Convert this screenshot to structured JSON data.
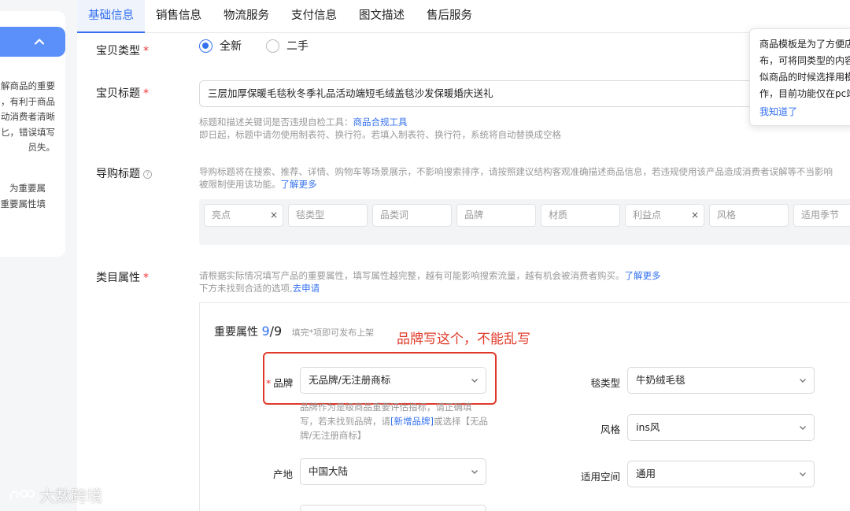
{
  "left_panel": {
    "text1": [
      "解商品的重要",
      "，有利于商品",
      "动消费者清晰",
      "匕，错误填写",
      "员失。"
    ],
    "text2": [
      "为重要属",
      "重要属性填"
    ]
  },
  "tabs": [
    "基础信息",
    "销售信息",
    "物流服务",
    "支付信息",
    "图文描述",
    "售后服务"
  ],
  "item_type": {
    "label": "宝贝类型",
    "options": [
      "全新",
      "二手"
    ],
    "selected": "全新"
  },
  "item_title": {
    "label": "宝贝标题",
    "value": "三层加厚保暖毛毯秋冬季礼品活动端短毛绒盖毯沙发保暖婚庆送礼",
    "hint_line1_prefix": "标题和描述关键词是否违规自检工具：",
    "hint_line1_link": "商品合规工具",
    "hint_line2": "即日起，标题中请勿使用制表符、换行符。若填入制表符、换行符，系统将自动替换成空格"
  },
  "guide_title": {
    "label": "导购标题",
    "hint_line1": "导购标题将在搜索、推荐、详情、购物车等场景展示，不影响搜索排序，请按照建议结构客观准确描述商品信息，若违规使用该产品造成消费者误解等不当影响",
    "hint_line2_prefix": "被限制使用该功能。",
    "hint_line2_link": "了解更多",
    "chips": [
      {
        "text": "亮点",
        "clear": "×"
      },
      {
        "text": "毯类型",
        "clear": ""
      },
      {
        "text": "品类词",
        "clear": ""
      },
      {
        "text": "品牌",
        "clear": ""
      },
      {
        "text": "材质",
        "clear": ""
      },
      {
        "text": "利益点",
        "clear": "×"
      },
      {
        "text": "风格",
        "clear": ""
      },
      {
        "text": "适用季节",
        "clear": ""
      }
    ]
  },
  "category_attrs": {
    "label": "类目属性",
    "hint_line1_prefix": "请根据实际情况填写产品的重要属性，填写属性越完整，越有可能影响搜索流量，越有机会被消费者购买。",
    "hint_line1_link": "了解更多",
    "hint_line2_prefix": "下方未找到合适的选项,",
    "hint_line2_link": "去申请",
    "section_title": "重要属性",
    "count_filled": "9",
    "count_total": "/9",
    "section_hint": "填完*项即可发布上架",
    "annotation": "品牌写这个，不能乱写",
    "fields": {
      "brand": {
        "label": "品牌",
        "value": "无品牌/无注册商标"
      },
      "blanket_type": {
        "label": "毯类型",
        "value": "牛奶绒毛毯"
      },
      "style": {
        "label": "风格",
        "value": "ins风"
      },
      "origin": {
        "label": "产地",
        "value": "中国大陆"
      },
      "space": {
        "label": "适用空间",
        "value": "通用"
      }
    },
    "brand_hint_prefix": "品牌作为是级商品重要评估指标，请正确填写，若未找到品牌，请",
    "brand_hint_link": "[新增品牌]",
    "brand_hint_suffix": "或选择【无品牌/无注册商标】"
  },
  "tooltip": {
    "lines": [
      "商品模板是为了方便店",
      "布，可将同类型的内容",
      "似商品的时候选择用模",
      "作，目前功能仅在pc端"
    ],
    "link": "我知道了"
  },
  "watermark": "大数跨境",
  "colors": {
    "accent": "#3471f0",
    "required": "#e33333",
    "annotation": "#e03b2b",
    "collapse_button": "#5b8ff9"
  }
}
